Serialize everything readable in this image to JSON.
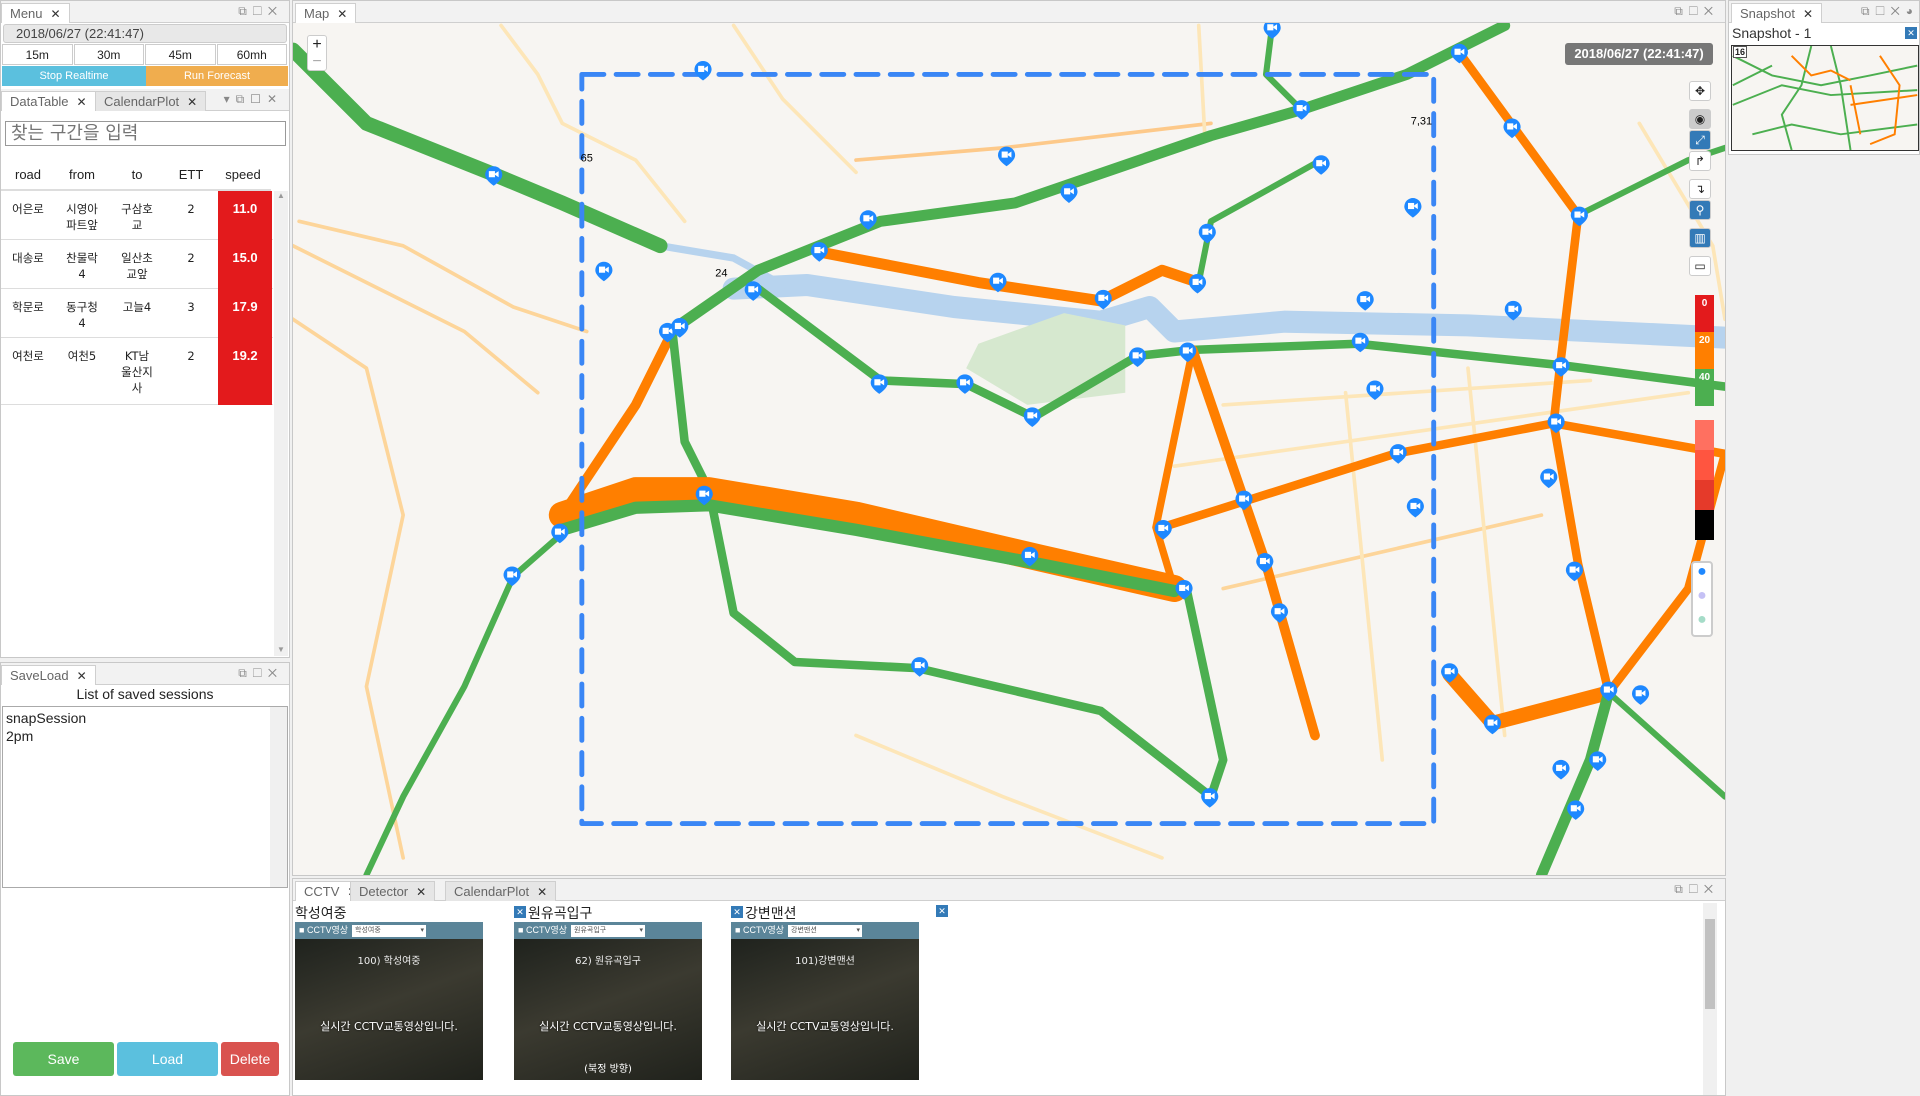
{
  "menu": {
    "tab": "Menu",
    "datetime": "2018/06/27 (22:41:47)",
    "intervals": [
      "15m",
      "30m",
      "45m",
      "60mh"
    ],
    "stop_realtime": "Stop Realtime",
    "run_forecast": "Run Forecast"
  },
  "datatable": {
    "tabs": [
      "DataTable",
      "CalendarPlot"
    ],
    "search_placeholder": "찾는 구간을 입력",
    "columns": [
      "road",
      "from",
      "to",
      "ETT",
      "speed"
    ],
    "rows": [
      {
        "road": "어은로",
        "from": "시영아\n파트앞",
        "to": "구삼호\n교",
        "ett": "2",
        "speed": "11.0"
      },
      {
        "road": "대송로",
        "from": "찬물락\n4",
        "to": "일산초\n교앞",
        "ett": "2",
        "speed": "15.0"
      },
      {
        "road": "학문로",
        "from": "동구청\n4",
        "to": "고늘4",
        "ett": "3",
        "speed": "17.9"
      },
      {
        "road": "여천로",
        "from": "여천5",
        "to": "KT남\n울산지\n사",
        "ett": "2",
        "speed": "19.2"
      }
    ],
    "speed_color": "#e31a1c"
  },
  "saveload": {
    "tab": "SaveLoad",
    "title": "List of saved sessions",
    "sessions": [
      "snapSession",
      "2pm"
    ],
    "save": "Save",
    "load": "Load",
    "delete": "Delete"
  },
  "map": {
    "tab": "Map",
    "timestamp": "2018/06/27 (22:41:47)",
    "zoom_in": "+",
    "zoom_out": "−",
    "route_labels": [
      "65",
      "24",
      "7,31"
    ],
    "legend": {
      "labels": [
        "0",
        "20",
        "40"
      ],
      "colors": [
        "#e31a1c",
        "#ff7f00",
        "#4caf50"
      ],
      "extra_colors": [
        "#ff7060",
        "#ff5540",
        "#e53a2a",
        "#000000"
      ]
    },
    "road_colors": {
      "congested": "#ff7f00",
      "free": "#4caf50"
    },
    "tools": [
      "move-icon",
      "screenshot-icon",
      "expand-icon",
      "step-up-icon",
      "step-down-icon",
      "network-icon",
      "map-icon",
      "map-outline-icon"
    ],
    "layers": [
      "cctv-layer-icon",
      "detector-layer-icon",
      "wifi-layer-icon"
    ]
  },
  "snapshot": {
    "tab": "Snapshot",
    "title": "Snapshot - 1",
    "route_label": "16"
  },
  "bottom": {
    "tabs": [
      "CCTV",
      "Detector",
      "CalendarPlot"
    ],
    "cctv": [
      {
        "name": "학성여중",
        "bar": "CCTV영상",
        "select": "학성여중",
        "overlay": "100) 학성여중",
        "caption": "실시간 CCTV교통영상입니다."
      },
      {
        "name": "원유곡입구",
        "bar": "CCTV영상",
        "select": "원유곡입구",
        "overlay": "62) 원유곡입구",
        "caption": "실시간 CCTV교통영상입니다.",
        "sub": "(북정 방향)"
      },
      {
        "name": "강변맨션",
        "bar": "CCTV영상",
        "select": "강변맨션",
        "overlay": "101)강변맨션",
        "caption": "실시간 CCTV교통영상입니다."
      }
    ]
  }
}
